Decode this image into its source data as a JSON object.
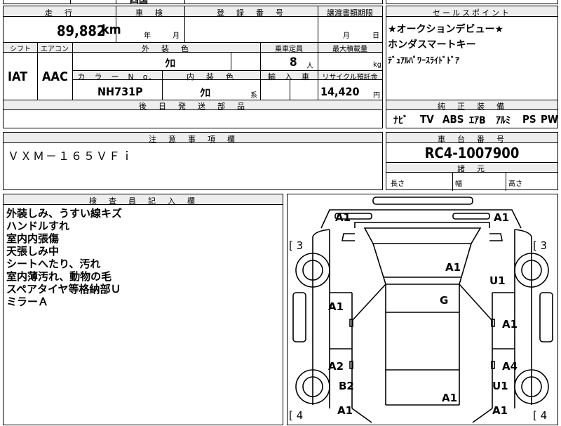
{
  "top_row": {
    "top_fragment": "四国",
    "right_fragment": ""
  },
  "headers": {
    "mileage": "走　行",
    "inspection": "車　検",
    "registration": "登　録　番　号",
    "transfer": "譲渡書類期限",
    "selling_point": "セールスポイント",
    "shift": "シフト",
    "aircon": "エアコン",
    "exterior_color": "外　装　色",
    "capacity": "乗車定員",
    "max_load": "最大積載量",
    "color_no": "カ　ラ　ー　N　o．",
    "interior_color": "内　装　色",
    "import": "輸　入　車",
    "recycle": "リサイクル預託金",
    "parts": "後　日　発　送　部　品",
    "standard_equipment": "純　正　装　備",
    "caution": "注　意　事　項　欄",
    "chassis": "車　台　番　号",
    "dimensions": "諸　元",
    "inspector": "検　査　員　記　入　欄"
  },
  "values": {
    "mileage": "89,882",
    "mileage_unit": "km",
    "inspection_year": "年",
    "inspection_month": "月",
    "transfer_month": "月",
    "transfer_day": "日",
    "shift": "IAT",
    "aircon": "AAC",
    "exterior_color": "ｸﾛ",
    "capacity": "8",
    "capacity_unit": "人",
    "max_load_unit": "kg",
    "color_no": "NH731P",
    "interior_color": "ｸﾛ",
    "interior_suffix": "系",
    "recycle": "14,420",
    "recycle_unit": "円",
    "caution": "ＶＸＭ－１６５ＶＦｉ",
    "chassis": "RC4-1007900",
    "dim_length": "長さ",
    "dim_width": "幅",
    "dim_height": "高さ"
  },
  "selling_points": [
    "★オークションデビュー★",
    "ホンダスマートキー",
    "ﾃﾞｭｱﾙﾊﾟﾜｰｽﾗｲﾄﾞﾄﾞｱ"
  ],
  "equipment": [
    "ﾅﾋﾞ",
    "TV",
    "ABS",
    "ｴｱB",
    "ｱﾙﾐ",
    "PS",
    "PW"
  ],
  "inspector_remarks": [
    "外装しみ、うすい線キズ",
    "ハンドルすれ",
    "室内内張傷",
    "天張しみ中",
    "シートへたり、汚れ",
    "室内薄汚れ、動物の毛",
    "スペアタイヤ等格納部Ｕ",
    "ミラーＡ"
  ],
  "damage_marks": {
    "front_left": "A1",
    "front_right": "A1",
    "bracket_left_top": "[ 3",
    "bracket_right_top": "[ 3",
    "bracket_left_bottom": "[ 4",
    "bracket_right_bottom": "[ 4",
    "hood": "A1",
    "right_fender": "U1",
    "roof": "G",
    "left_front_door": "A1",
    "right_front_door": "A1",
    "left_rear_door": "A2",
    "right_rear_door": "A4",
    "left_rear_fender": "B2",
    "right_rear_fender": "U1",
    "rear_left": "A1",
    "rear_center": "A1",
    "rear_right": "A1"
  }
}
